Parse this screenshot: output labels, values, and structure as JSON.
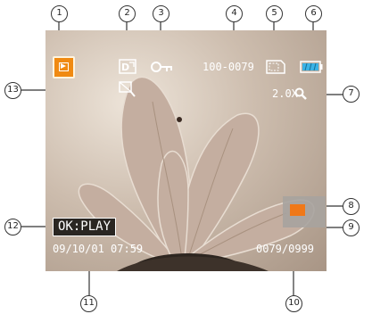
{
  "screen": {
    "file_number": "100-0079",
    "zoom_level": "2.0X",
    "datetime": "09/10/01 07:59",
    "counter": "0079/0999",
    "ok_label": "OK:PLAY",
    "battery_level": 1.0
  },
  "icons": {
    "playback_mode": "play-mode-icon",
    "dpof": "dpof-icon",
    "protect": "key-lock-icon",
    "memory": "memory-card-icon",
    "battery": "battery-icon",
    "zoom": "magnifier-icon",
    "audio_memo": "no-image-icon"
  },
  "callouts": [
    "1",
    "2",
    "3",
    "4",
    "5",
    "6",
    "7",
    "8",
    "9",
    "10",
    "11",
    "12",
    "13"
  ],
  "colors": {
    "accent": "#f08a12",
    "battery": "#3bb3e6"
  }
}
